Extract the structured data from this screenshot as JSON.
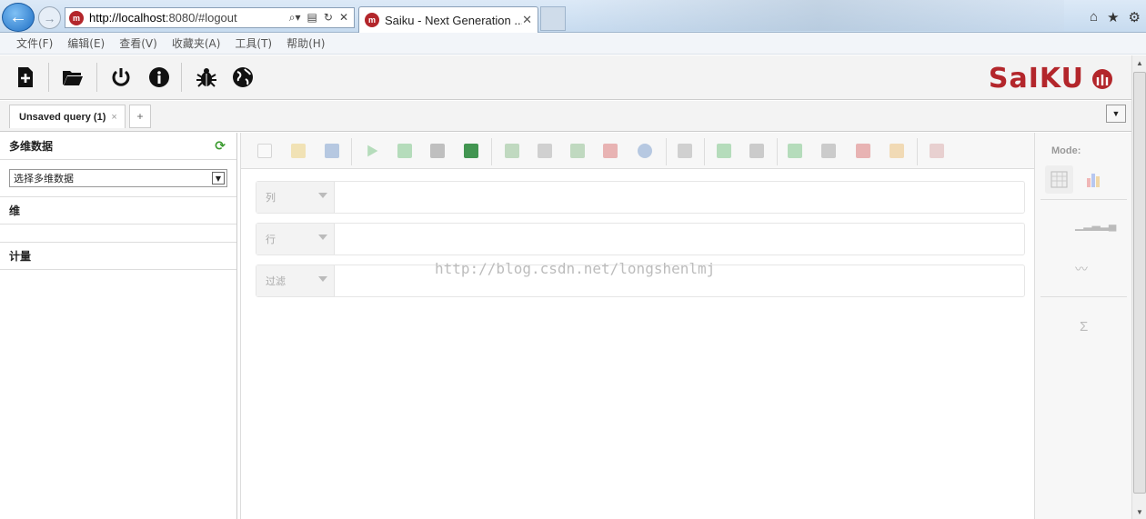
{
  "browser": {
    "url_host": "http://localhost",
    "url_rest": ":8080/#logout",
    "tab_title": "Saiku - Next Generation ...",
    "favicon_letter": "m",
    "back_label": "←",
    "forward_label": "→",
    "tab_close": "✕",
    "chrome_icons": [
      "home-icon",
      "star-icon",
      "gear-icon"
    ]
  },
  "menubar": {
    "items": [
      "文件(F)",
      "编辑(E)",
      "查看(V)",
      "收藏夹(A)",
      "工具(T)",
      "帮助(H)"
    ]
  },
  "toolbar": {
    "buttons": [
      "new-query-icon",
      "open-query-icon",
      "logout-icon",
      "about-icon",
      "bug-icon",
      "globe-icon"
    ],
    "logo_text": "SaIKU"
  },
  "tabs": {
    "active_label": "Unsaved query (1)",
    "close": "×",
    "add": "+",
    "dropdown": "▼"
  },
  "left": {
    "cubes_header": "多维数据",
    "cube_select": "选择多维数据",
    "dimensions_header": "维",
    "measures_header": "计量",
    "refresh": "⟳"
  },
  "workspace": {
    "axes": {
      "columns": "列",
      "rows": "行",
      "filter": "过滤"
    },
    "watermark": "http://blog.csdn.net/longshenlmj"
  },
  "right": {
    "mode_label": "Mode:",
    "sigma": "Σ"
  },
  "colors": {
    "brand": "#b3262b",
    "refresh": "#3a9a2e"
  }
}
